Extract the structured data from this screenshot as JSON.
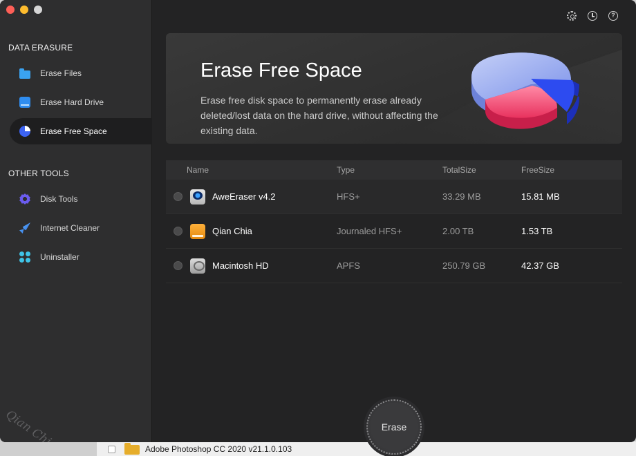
{
  "window": {
    "controls": [
      "close",
      "minimize",
      "zoom"
    ]
  },
  "sidebar": {
    "section1_title": "DATA ERASURE",
    "section1_items": [
      {
        "label": "Erase Files",
        "icon": "folder-icon"
      },
      {
        "label": "Erase Hard Drive",
        "icon": "drive-icon"
      },
      {
        "label": "Erase Free Space",
        "icon": "pie-chart-icon",
        "active": true
      }
    ],
    "section2_title": "OTHER TOOLS",
    "section2_items": [
      {
        "label": "Disk Tools",
        "icon": "gear-icon"
      },
      {
        "label": "Internet Cleaner",
        "icon": "rocket-icon"
      },
      {
        "label": "Uninstaller",
        "icon": "apps-icon"
      }
    ],
    "watermark": "Qian Chia Soft"
  },
  "toolbar": {
    "icons": [
      "settings-icon",
      "history-icon",
      "help-icon"
    ]
  },
  "banner": {
    "title": "Erase Free Space",
    "description": "Erase free disk space to permanently erase already deleted/lost data on the hard drive, without affecting the existing data."
  },
  "table": {
    "headers": {
      "name": "Name",
      "type": "Type",
      "total": "TotalSize",
      "free": "FreeSize"
    },
    "rows": [
      {
        "name": "AweEraser v4.2",
        "type": "HFS+",
        "total": "33.29 MB",
        "free": "15.81 MB",
        "icon": "usb-drive-icon"
      },
      {
        "name": "Qian Chia",
        "type": "Journaled HFS+",
        "total": "2.00 TB",
        "free": "1.53 TB",
        "icon": "external-drive-icon"
      },
      {
        "name": "Macintosh HD",
        "type": "APFS",
        "total": "250.79 GB",
        "free": "42.37 GB",
        "icon": "internal-drive-icon"
      }
    ]
  },
  "erase_button": {
    "label": "Erase"
  },
  "background_window": {
    "text": "Adobe Photoshop CC 2020 v21.1.0.103"
  },
  "colors": {
    "accent": "#3c63f2",
    "pie_blue": "#8fa6ef",
    "pie_red": "#f0476d"
  }
}
